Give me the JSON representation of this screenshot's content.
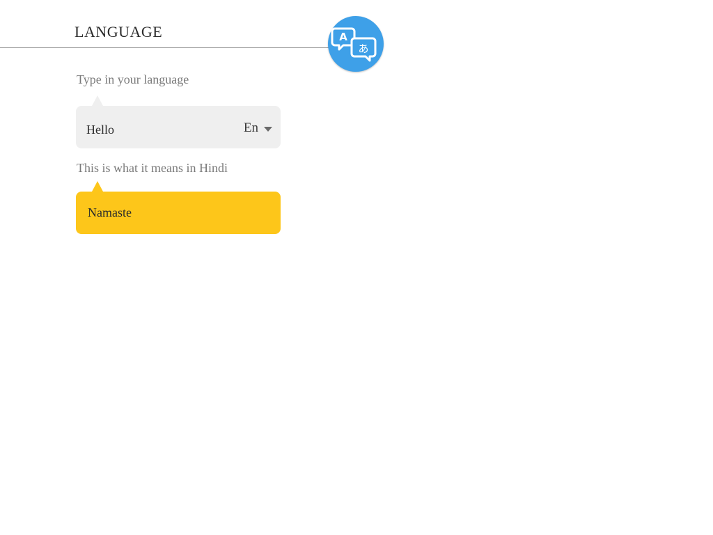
{
  "header": {
    "title": "LANGUAGE",
    "logo_icon": "translate-icon",
    "logo_glyph_latin": "A",
    "logo_glyph_japanese": "あ",
    "logo_color": "#3ea0e8"
  },
  "translator": {
    "source_label": "Type in your language",
    "input_value": "Hello",
    "source_language_code": "En",
    "target_label": "This is what it means in Hindi",
    "output_value": "Namaste",
    "output_color": "#fdc61a",
    "input_color": "#efefef"
  }
}
